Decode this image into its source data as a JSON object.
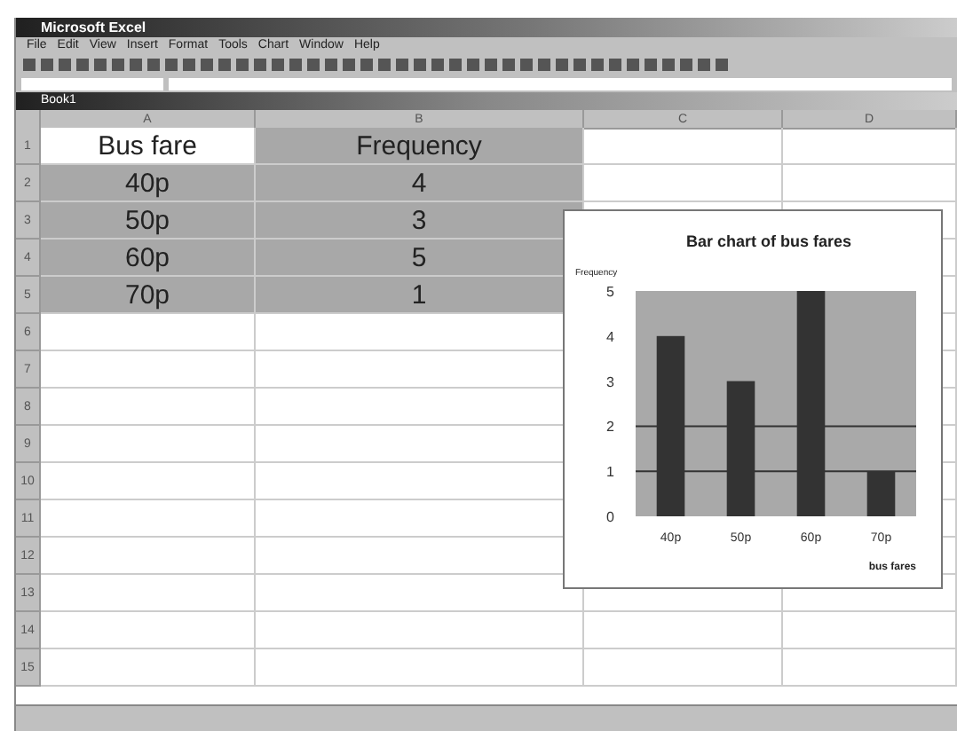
{
  "window": {
    "title": "Microsoft Excel"
  },
  "menu": [
    "File",
    "Edit",
    "View",
    "Insert",
    "Format",
    "Tools",
    "Chart",
    "Window",
    "Help"
  ],
  "workbook": {
    "title": "Book1"
  },
  "table": {
    "columns": [
      "A",
      "B",
      "C",
      "D"
    ],
    "rows": [
      {
        "number": "1",
        "selected": true,
        "cells": [
          {
            "text": "Bus fare",
            "active": true
          },
          {
            "text": "Frequency",
            "active": false
          }
        ]
      },
      {
        "number": "2",
        "selected": true,
        "cells": [
          {
            "text": "40p",
            "active": false
          },
          {
            "text": "4",
            "active": false
          }
        ]
      },
      {
        "number": "3",
        "selected": true,
        "cells": [
          {
            "text": "50p",
            "active": false
          },
          {
            "text": "3",
            "active": false
          }
        ]
      },
      {
        "number": "4",
        "selected": true,
        "cells": [
          {
            "text": "60p",
            "active": false
          },
          {
            "text": "5",
            "active": false
          }
        ]
      },
      {
        "number": "5",
        "selected": true,
        "cells": [
          {
            "text": "70p",
            "active": false
          },
          {
            "text": "1",
            "active": false
          }
        ]
      }
    ],
    "empty_rows": [
      "6",
      "7",
      "8",
      "9",
      "10",
      "11",
      "12",
      "13",
      "14",
      "15"
    ]
  },
  "chart": {
    "chart_data": {
      "type": "bar",
      "title": "Bar chart of bus fares",
      "xlabel": "bus fares",
      "ylabel": "Frequency",
      "categories": [
        "40p",
        "50p",
        "60p",
        "70p"
      ],
      "values": [
        4,
        3,
        5,
        1
      ],
      "ylim": [
        0,
        5
      ],
      "yticks": [
        0,
        1,
        2,
        3,
        4,
        5
      ]
    }
  }
}
